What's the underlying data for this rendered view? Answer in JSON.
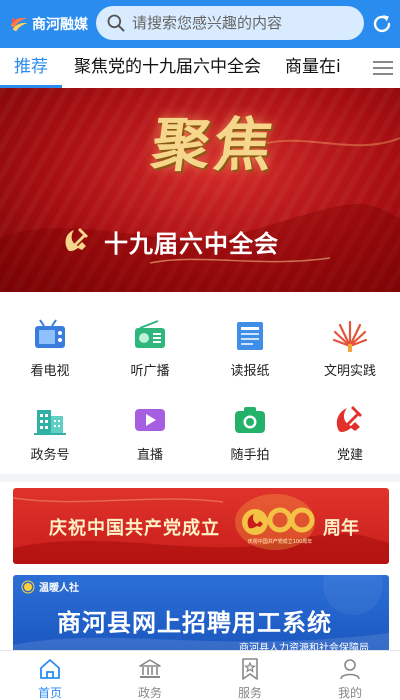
{
  "header": {
    "app_name": "商河融媒",
    "search_placeholder": "请搜索您感兴趣的内容"
  },
  "tabs": [
    {
      "label": "推荐",
      "active": true
    },
    {
      "label": "聚焦党的十九届六中全会",
      "active": false
    },
    {
      "label": "商量在i",
      "active": false
    }
  ],
  "banner": {
    "headline": "聚焦",
    "subtitle": "十九届六中全会"
  },
  "grid": [
    {
      "label": "看电视",
      "icon": "tv-icon"
    },
    {
      "label": "听广播",
      "icon": "radio-icon"
    },
    {
      "label": "读报纸",
      "icon": "newspaper-icon"
    },
    {
      "label": "文明实践",
      "icon": "civilization-icon"
    },
    {
      "label": "政务号",
      "icon": "government-building-icon"
    },
    {
      "label": "直播",
      "icon": "video-live-icon"
    },
    {
      "label": "随手拍",
      "icon": "camera-icon"
    },
    {
      "label": "党建",
      "icon": "party-emblem-icon"
    }
  ],
  "promos": {
    "party": {
      "left_text": "庆祝中国共产党成立",
      "badge_number": "100",
      "right_text": "周年",
      "badge_small": "庆祝中国共产党成立100周年"
    },
    "recruit": {
      "corner_text": "温暖人社",
      "title": "商河县网上招聘用工系统",
      "footer": "商河县人力资源和社会保障局"
    }
  },
  "bottom_nav": [
    {
      "label": "首页",
      "icon": "home-icon",
      "active": true
    },
    {
      "label": "政务",
      "icon": "government-icon",
      "active": false
    },
    {
      "label": "服务",
      "icon": "service-icon",
      "active": false
    },
    {
      "label": "我的",
      "icon": "user-icon",
      "active": false
    }
  ],
  "colors": {
    "primary": "#2b8cf0",
    "search_bg": "#d9ecff",
    "banner_red": "#b81518",
    "gold": "#f6d68a"
  }
}
